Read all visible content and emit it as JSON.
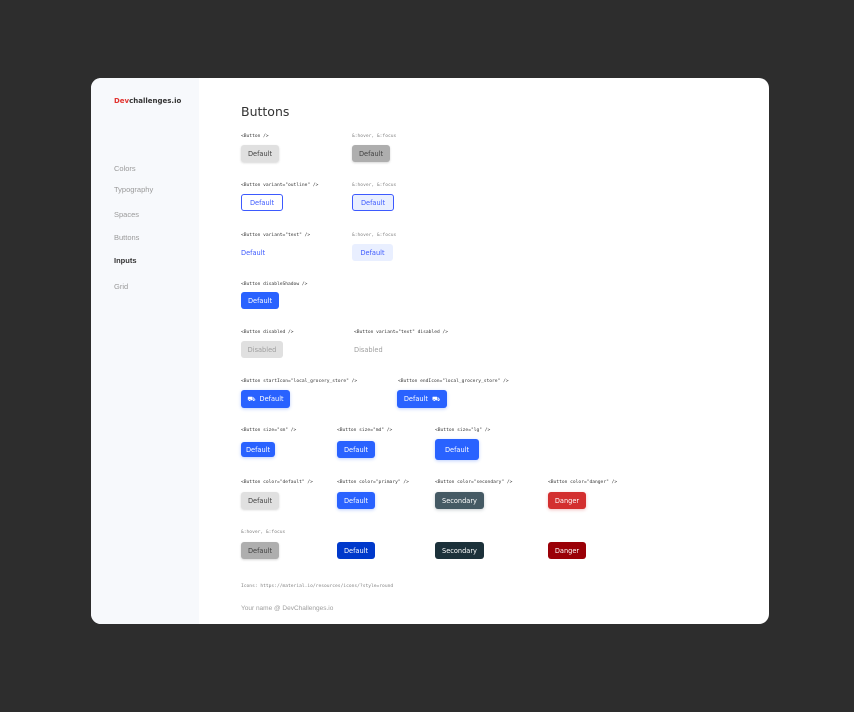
{
  "brand": {
    "accent": "Dev",
    "rest": "challenges.io"
  },
  "sidebar": {
    "items": [
      {
        "label": "Colors",
        "active": false
      },
      {
        "label": "Typography",
        "active": false
      },
      {
        "label": "Spaces",
        "active": false
      },
      {
        "label": "Buttons",
        "active": false
      },
      {
        "label": "Inputs",
        "active": true
      },
      {
        "label": "Grid",
        "active": false
      }
    ]
  },
  "page": {
    "title": "Buttons"
  },
  "sections": {
    "default": {
      "code": "<Button />",
      "hover_code": "&:hover, &:focus",
      "label": "Default",
      "hover_label": "Default"
    },
    "outline": {
      "code": "<Button variant=\"outline\" />",
      "hover_code": "&:hover, &:focus",
      "label": "Default",
      "hover_label": "Default"
    },
    "text": {
      "code": "<Button variant=\"text\" />",
      "hover_code": "&:hover, &:focus",
      "label": "Default",
      "hover_label": "Default"
    },
    "noshadow": {
      "code": "<Button disableShadow />",
      "label": "Default"
    },
    "disabled": {
      "code": "<Button disabled />",
      "label": "Disabled",
      "text_code": "<Button variant=\"text\" disabled />",
      "text_label": "Disabled"
    },
    "icons": {
      "start_code": "<Button startIcon=\"local_grocery_store\" />",
      "start_label": "Default",
      "end_code": "<Button endIcon=\"local_grocery_store\" />",
      "end_label": "Default",
      "icon_name": "grocery-cart-icon",
      "icon_glyph": "⛟"
    },
    "sizes": {
      "sm_code": "<Button size=\"sm\" />",
      "md_code": "<Button size=\"md\" />",
      "lg_code": "<Button size=\"lg\" />",
      "sm_label": "Default",
      "md_label": "Default",
      "lg_label": "Default"
    },
    "colors": {
      "default_code": "<Button color=\"default\" />",
      "primary_code": "<Button color=\"primary\" />",
      "secondary_code": "<Button color=\"secondary\" />",
      "danger_code": "<Button color=\"danger\" />",
      "default_label": "Default",
      "primary_label": "Default",
      "secondary_label": "Secondary",
      "danger_label": "Danger"
    },
    "color_hover": {
      "code": "&:hover, &:focus",
      "default_label": "Default",
      "primary_label": "Default",
      "secondary_label": "Secondary",
      "danger_label": "Danger"
    }
  },
  "footer": {
    "source": "Icons: https://material.io/resources/icons/?style=round",
    "credit": "Your name @ DevChallenges.io"
  },
  "colors": {
    "primary": "#2962ff",
    "secondary": "#455a64",
    "danger": "#d32f2f",
    "brand_accent": "#e2332f"
  }
}
